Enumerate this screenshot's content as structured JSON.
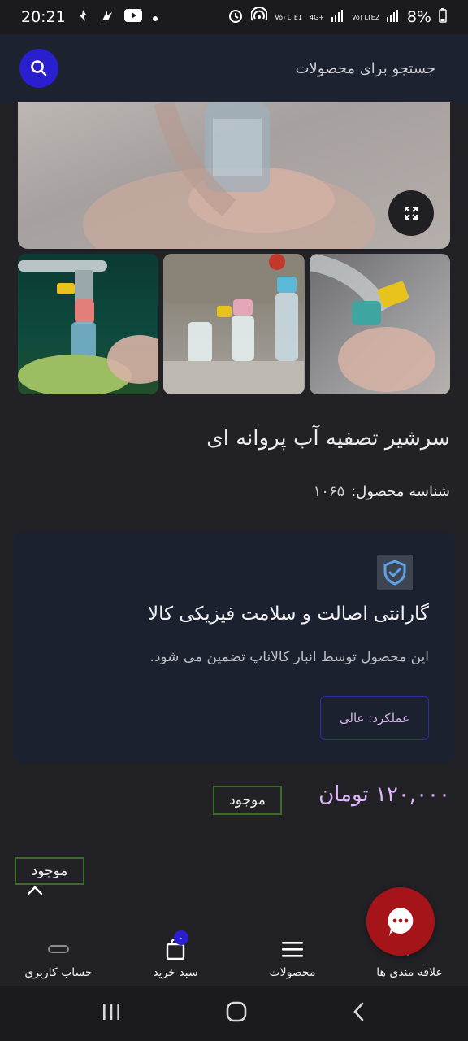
{
  "status_bar": {
    "time": "20:21",
    "network_1": "Vo) LTE1",
    "network_type": "4G+",
    "network_2": "Vo) LTE2",
    "battery": "8%"
  },
  "search": {
    "placeholder": "جستجو برای محصولات"
  },
  "product": {
    "title": "سرشیر تصفیه آب پروانه ای",
    "code_label": "شناسه محصول:",
    "code_value": "۱۰۶۵"
  },
  "guarantee": {
    "title": "گارانتی اصالت و سلامت فیزیکی کالا",
    "description": "این محصول توسط انبار کالاناپ تضمین می شود.",
    "performance": "عملکرد: عالی"
  },
  "price": {
    "value": "۱۲۰,۰۰۰ تومان",
    "stock": "موجود",
    "stock_secondary": "موجود"
  },
  "bottom_nav": {
    "items": [
      {
        "label": "علاقه مندی ها",
        "icon": "heart-check-icon"
      },
      {
        "label": "محصولات",
        "icon": "menu-icon"
      },
      {
        "label": "سبد خرید",
        "icon": "cart-icon",
        "badge": "۰"
      },
      {
        "label": "حساب کاربری",
        "icon": "user-icon"
      }
    ]
  },
  "colors": {
    "accent": "#2a1fcf",
    "price": "#e2b6ff",
    "chat": "#a51418",
    "stock_border": "#3c6b2a"
  }
}
